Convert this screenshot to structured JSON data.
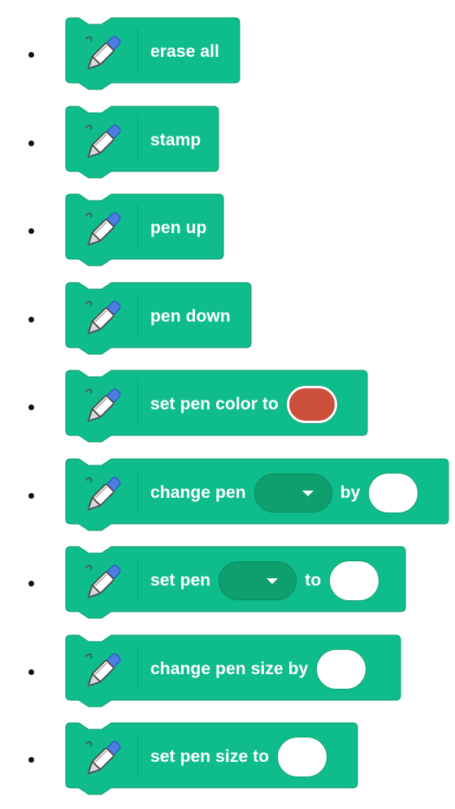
{
  "colors": {
    "block_fill": "#0fbd8c",
    "block_stroke": "#0b9a6d",
    "color_well": "#cb4f3a",
    "dropdown_fill": "#0f9f6e"
  },
  "blocks": [
    {
      "icon": "pen-icon",
      "parts": [
        {
          "type": "text",
          "text": "erase all"
        }
      ]
    },
    {
      "icon": "pen-icon",
      "parts": [
        {
          "type": "text",
          "text": "stamp"
        }
      ]
    },
    {
      "icon": "pen-icon",
      "parts": [
        {
          "type": "text",
          "text": "pen up"
        }
      ]
    },
    {
      "icon": "pen-icon",
      "parts": [
        {
          "type": "text",
          "text": "pen down"
        }
      ]
    },
    {
      "icon": "pen-icon",
      "parts": [
        {
          "type": "text",
          "text": "set pen color to"
        },
        {
          "type": "color",
          "value": "#cb4f3a"
        }
      ]
    },
    {
      "icon": "pen-icon",
      "parts": [
        {
          "type": "text",
          "text": "change pen"
        },
        {
          "type": "dropdown",
          "value": ""
        },
        {
          "type": "text",
          "text": "by"
        },
        {
          "type": "input",
          "value": ""
        }
      ]
    },
    {
      "icon": "pen-icon",
      "parts": [
        {
          "type": "text",
          "text": "set pen"
        },
        {
          "type": "dropdown",
          "value": ""
        },
        {
          "type": "text",
          "text": "to"
        },
        {
          "type": "input",
          "value": ""
        }
      ]
    },
    {
      "icon": "pen-icon",
      "parts": [
        {
          "type": "text",
          "text": "change pen size by"
        },
        {
          "type": "input",
          "value": ""
        }
      ]
    },
    {
      "icon": "pen-icon",
      "parts": [
        {
          "type": "text",
          "text": "set pen size to"
        },
        {
          "type": "input",
          "value": ""
        }
      ]
    }
  ]
}
